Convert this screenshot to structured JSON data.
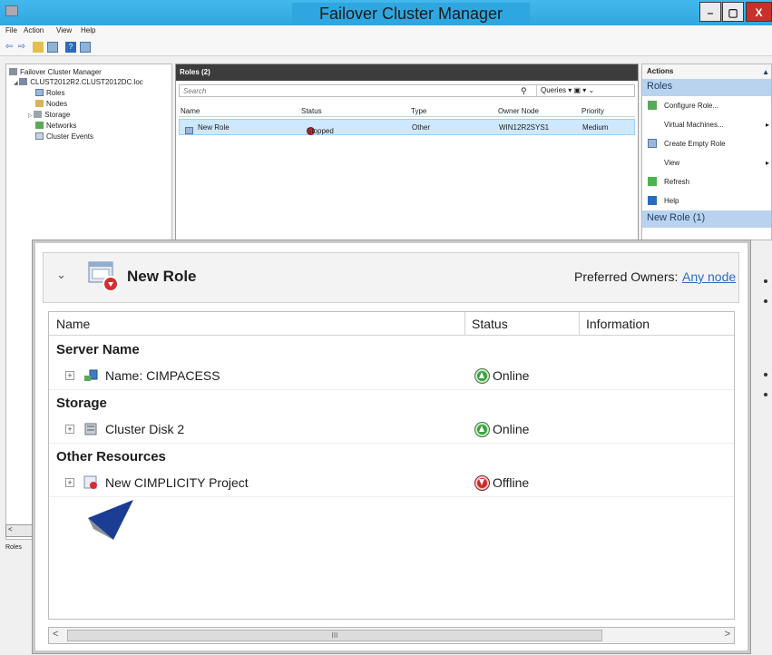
{
  "window": {
    "title": "Failover Cluster Manager",
    "controls": [
      "–",
      "▢",
      "X"
    ]
  },
  "menu": [
    "File",
    "Action",
    "View",
    "Help"
  ],
  "tree": {
    "items": [
      {
        "label": "Failover Cluster Manager"
      },
      {
        "label": "CLUST2012R2.CLUST2012DC.loc"
      },
      {
        "label": "Roles"
      },
      {
        "label": "Nodes"
      },
      {
        "label": "Storage"
      },
      {
        "label": "Networks"
      },
      {
        "label": "Cluster Events"
      }
    ],
    "status": "Roles"
  },
  "roles_pane": {
    "header": "Roles (2)",
    "search_placeholder": "Search",
    "queries_label": "Queries",
    "columns": [
      "Name",
      "Status",
      "Type",
      "Owner Node",
      "Priority"
    ],
    "rows": [
      {
        "name": "New Role",
        "status": "Stopped",
        "type": "Other",
        "owner": "WIN12R2SYS1",
        "priority": "Medium"
      }
    ]
  },
  "actions": {
    "title": "Actions",
    "section": "Roles",
    "items": [
      {
        "label": "Configure Role..."
      },
      {
        "label": "Virtual Machines..."
      },
      {
        "label": "Create Empty Role"
      },
      {
        "label": "View"
      },
      {
        "label": "Refresh"
      },
      {
        "label": "Help"
      }
    ],
    "section2": "New Role (1)"
  },
  "detail": {
    "role_name": "New Role",
    "preferred_owners_label": "Preferred Owners:",
    "preferred_owners_value": "Any node",
    "columns": [
      "Name",
      "Status",
      "Information"
    ],
    "groups": [
      {
        "title": "Server Name",
        "resources": [
          {
            "name": "Name: CIMPACESS",
            "status": "Online"
          }
        ]
      },
      {
        "title": "Storage",
        "resources": [
          {
            "name": "Cluster Disk 2",
            "status": "Online"
          }
        ]
      },
      {
        "title": "Other Resources",
        "resources": [
          {
            "name": "New CIMPLICITY Project",
            "status": "Offline"
          }
        ]
      }
    ],
    "scroll_left": "<",
    "scroll_right": ">",
    "scroll_thumb": "III"
  },
  "colors": {
    "titlebar": "#2ea7e0",
    "online": "#3ca23c",
    "offline": "#cf2a2a",
    "link": "#2a6bc7",
    "pointer": "#1c3d94"
  }
}
